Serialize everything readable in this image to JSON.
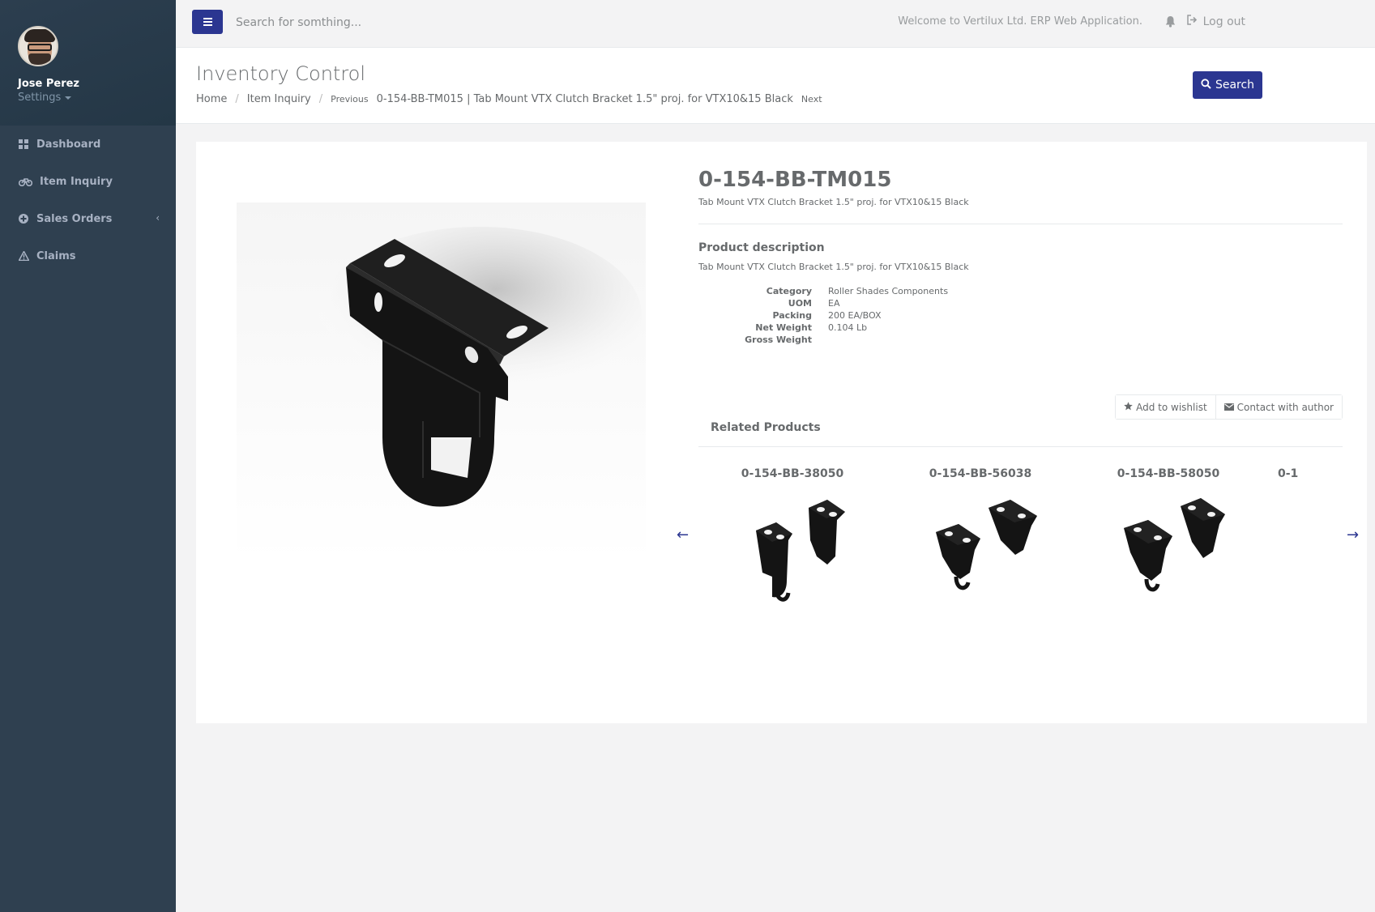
{
  "user": {
    "name": "Jose Perez",
    "settings_label": "Settings"
  },
  "sidebar": {
    "items": [
      {
        "label": "Dashboard",
        "icon": "dashboard-icon"
      },
      {
        "label": "Item Inquiry",
        "icon": "bicycle-icon"
      },
      {
        "label": "Sales Orders",
        "icon": "plus-circle-icon",
        "chevron": "‹"
      },
      {
        "label": "Claims",
        "icon": "warning-icon"
      }
    ]
  },
  "topbar": {
    "search_placeholder": "Search for somthing...",
    "welcome": "Welcome to Vertilux Ltd. ERP Web Application.",
    "logout_label": "Log out"
  },
  "heading": {
    "title": "Inventory Control",
    "breadcrumb": {
      "home": "Home",
      "item_inquiry": "Item Inquiry",
      "previous": "Previous",
      "current": "0-154-BB-TM015 | Tab Mount VTX Clutch Bracket 1.5\" proj. for VTX10&15 Black",
      "next": "Next"
    },
    "search_label": "Search"
  },
  "product": {
    "code": "0-154-BB-TM015",
    "subtitle": "Tab Mount VTX Clutch Bracket 1.5\" proj. for VTX10&15 Black",
    "description_title": "Product description",
    "description": "Tab Mount VTX Clutch Bracket 1.5\" proj. for VTX10&15 Black",
    "specs": {
      "category_label": "Category",
      "category": "Roller Shades Components",
      "uom_label": "UOM",
      "uom": "EA",
      "packing_label": "Packing",
      "packing": "200 EA/BOX",
      "net_weight_label": "Net Weight",
      "net_weight": "0.104 Lb",
      "gross_weight_label": "Gross Weight",
      "gross_weight": ""
    },
    "wishlist_label": "Add to wishlist",
    "contact_label": "Contact with author"
  },
  "related": {
    "title": "Related Products",
    "items": [
      {
        "code": "0-154-BB-38050"
      },
      {
        "code": "0-154-BB-56038"
      },
      {
        "code": "0-154-BB-58050"
      },
      {
        "code": "0-1"
      }
    ],
    "prev_arrow": "←",
    "next_arrow": "→"
  },
  "colors": {
    "sidebar": "#2f4050",
    "accent": "#2b3691",
    "text": "#676a6c"
  }
}
